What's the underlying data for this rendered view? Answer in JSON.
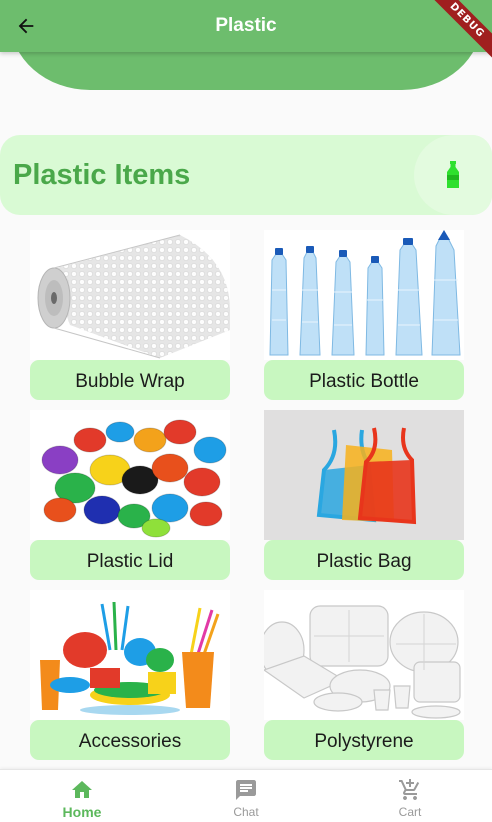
{
  "app_bar": {
    "title": "Plastic",
    "debug_label": "DEBUG"
  },
  "header": {
    "title": "Plastic Items",
    "icon": "bottle-icon"
  },
  "items": [
    {
      "label": "Bubble Wrap",
      "icon": "bubble-wrap-image"
    },
    {
      "label": "Plastic Bottle",
      "icon": "plastic-bottle-image"
    },
    {
      "label": "Plastic Lid",
      "icon": "plastic-lid-image"
    },
    {
      "label": "Plastic Bag",
      "icon": "plastic-bag-image"
    },
    {
      "label": "Accessories",
      "icon": "accessories-image"
    },
    {
      "label": "Polystyrene",
      "icon": "polystyrene-image"
    }
  ],
  "bottom_nav": {
    "items": [
      {
        "label": "Home",
        "icon": "home-icon",
        "active": true
      },
      {
        "label": "Chat",
        "icon": "chat-icon",
        "active": false
      },
      {
        "label": "Cart",
        "icon": "cart-icon",
        "active": false
      }
    ]
  },
  "colors": {
    "primary": "#6dbd6d",
    "header_card": "#d9fad4",
    "label_bg": "#c8f7c0",
    "header_text": "#4aa84a",
    "active_nav": "#5cb85c"
  }
}
